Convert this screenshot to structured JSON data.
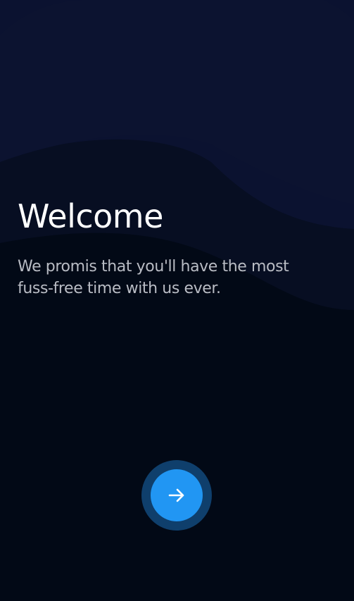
{
  "welcome": {
    "title": "Welcome",
    "subtitle": "We promis that you'll have the most fuss-free time with us ever."
  },
  "next_button": {
    "icon": "arrow-right-icon",
    "color": "#2196f3",
    "ring_color": "#0f3f6c"
  },
  "colors": {
    "background": "#020916",
    "wave_top": "#0c1330",
    "wave_mid": "#0a1128"
  }
}
